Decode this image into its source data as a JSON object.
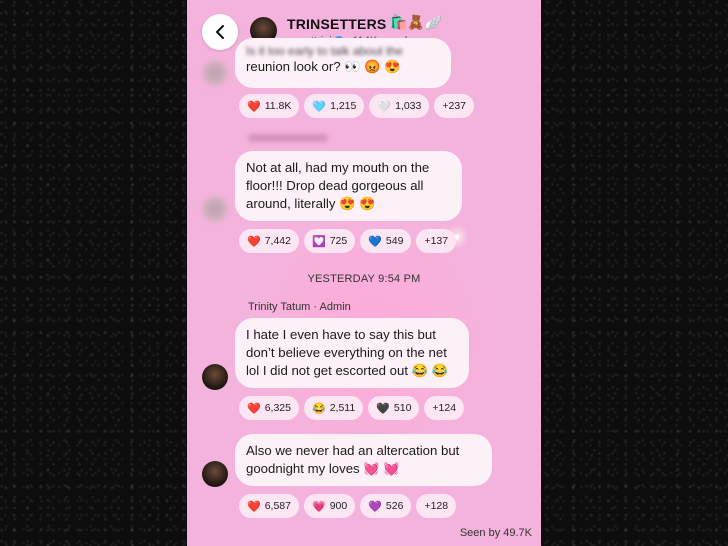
{
  "header": {
    "title": "TRINSETTERS",
    "title_emojis": "🛍️🧸🪽",
    "handle": "sooottrini",
    "members": "114K members"
  },
  "messages": [
    {
      "text_blurred": "Is it too early to talk about the",
      "text": "reunion look or? 👀 😡 😍",
      "reactions": [
        {
          "emoji": "❤️",
          "count": "11.8K"
        },
        {
          "emoji": "🩵",
          "count": "1,215"
        },
        {
          "emoji": "🤍",
          "count": "1,033"
        },
        {
          "emoji": "",
          "count": "+237"
        }
      ]
    },
    {
      "text": "Not at all, had my mouth on the floor!!! Drop dead gorgeous all around, literally 😍 😍",
      "reactions": [
        {
          "emoji": "❤️",
          "count": "7,442"
        },
        {
          "emoji": "💟",
          "count": "725"
        },
        {
          "emoji": "💙",
          "count": "549"
        },
        {
          "emoji": "",
          "count": "+137"
        }
      ]
    },
    {
      "text": "I hate I even have to say this but don’t believe everything on the net lol I did not get escorted out 😂 😂",
      "reactions": [
        {
          "emoji": "❤️",
          "count": "6,325"
        },
        {
          "emoji": "😂",
          "count": "2,511"
        },
        {
          "emoji": "🖤",
          "count": "510"
        },
        {
          "emoji": "",
          "count": "+124"
        }
      ]
    },
    {
      "text": "Also we never had an altercation but goodnight my loves 💓 💓",
      "reactions": [
        {
          "emoji": "❤️",
          "count": "6,587"
        },
        {
          "emoji": "💗",
          "count": "900"
        },
        {
          "emoji": "💜",
          "count": "526"
        },
        {
          "emoji": "",
          "count": "+128"
        }
      ]
    }
  ],
  "timestamp": "YESTERDAY 9:54 PM",
  "author": "Trinity Tatum · Admin",
  "seen": "Seen by 49.7K",
  "colors": {
    "background": "#0d0d0d",
    "chat_bg": "#f4b3dc",
    "bubble": "#fdf1f8",
    "pill": "#fde6f3"
  }
}
